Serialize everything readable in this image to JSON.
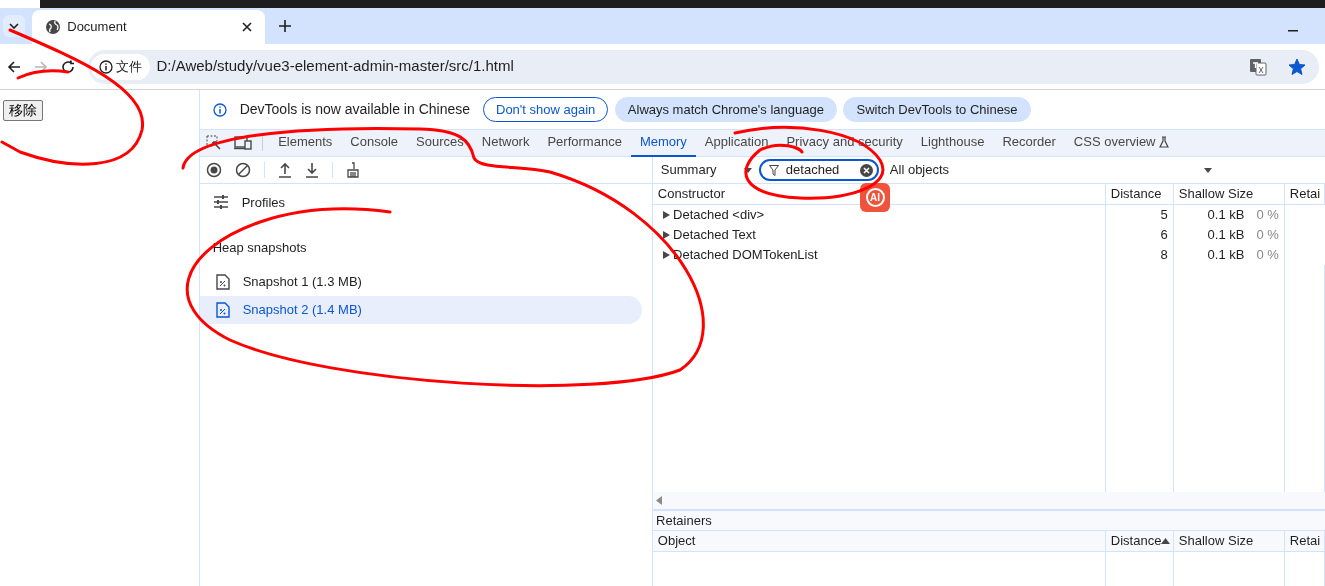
{
  "browser": {
    "tabs": [
      {
        "title": "Document",
        "selected": true
      }
    ],
    "nav": {
      "forward_disabled": true
    },
    "address": {
      "chip": "文件",
      "url": "D:/Aweb/study/vue3-element-admin-master/src/1.html",
      "bookmarked": true
    }
  },
  "page": {
    "button": "移除"
  },
  "devtools": {
    "infobar": {
      "message": "DevTools is now available in Chinese",
      "buttons": [
        {
          "label": "Don't show again",
          "kind": "outline"
        },
        {
          "label": "Always match Chrome's language",
          "kind": "filled"
        },
        {
          "label": "Switch DevTools to Chinese",
          "kind": "filled"
        }
      ]
    },
    "panel_tabs": [
      {
        "label": "Elements",
        "selected": false
      },
      {
        "label": "Console",
        "selected": false
      },
      {
        "label": "Sources",
        "selected": false
      },
      {
        "label": "Network",
        "selected": false
      },
      {
        "label": "Performance",
        "selected": false
      },
      {
        "label": "Memory",
        "selected": true
      },
      {
        "label": "Application",
        "selected": false
      },
      {
        "label": "Privacy and security",
        "selected": false
      },
      {
        "label": "Lighthouse",
        "selected": false
      },
      {
        "label": "Recorder",
        "selected": false
      },
      {
        "label": "CSS overview",
        "selected": false,
        "experimental": true
      }
    ],
    "sidebar": {
      "profiles_label": "Profiles",
      "section": "Heap snapshots",
      "snapshots": [
        {
          "label": "Snapshot 1 (1.3 MB)",
          "selected": false
        },
        {
          "label": "Snapshot 2 (1.4 MB)",
          "selected": true
        }
      ]
    },
    "toolbar": {
      "view": "Summary",
      "filter": "detached",
      "scope": "All objects"
    },
    "badge": "AI",
    "table": {
      "columns": [
        {
          "label": "Constructor"
        },
        {
          "label": "Distance"
        },
        {
          "label": "Shallow Size"
        },
        {
          "label": "Retai"
        }
      ],
      "rows": [
        {
          "constructor": "Detached <div>",
          "expanded": false,
          "distance": "5",
          "shallow_size": "0.1 kB",
          "shallow_percent": "0 %"
        },
        {
          "constructor": "Detached Text",
          "expanded": false,
          "distance": "6",
          "shallow_size": "0.1 kB",
          "shallow_percent": "0 %"
        },
        {
          "constructor": "Detached DOMTokenList",
          "expanded": false,
          "distance": "8",
          "shallow_size": "0.1 kB",
          "shallow_percent": "0 %"
        }
      ]
    },
    "retainers": {
      "title": "Retainers",
      "columns": [
        {
          "label": "Object"
        },
        {
          "label": "Distance",
          "sorted_ascending": true
        },
        {
          "label": "Shallow Size"
        },
        {
          "label": "Retai"
        }
      ]
    }
  }
}
